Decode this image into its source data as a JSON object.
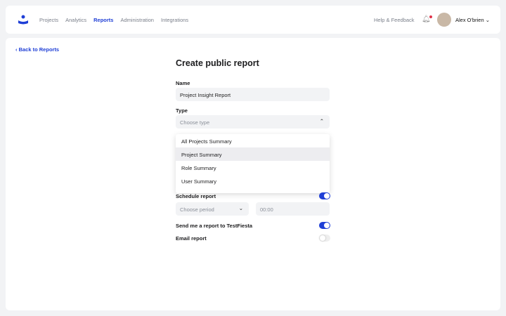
{
  "nav": {
    "items": [
      "Projects",
      "Analytics",
      "Reports",
      "Administration",
      "Integrations"
    ],
    "active": "Reports",
    "help": "Help & Feedback",
    "user": "Alex O'brien"
  },
  "back": "Back to Reports",
  "title": "Create public report",
  "name": {
    "label": "Name",
    "value": "Project Insight Report"
  },
  "type": {
    "label": "Type",
    "placeholder": "Choose type",
    "options": [
      "All Projects Summary",
      "Project Summary",
      "Role Summary",
      "User Summary"
    ],
    "hovered": "Project Summary"
  },
  "schedule": {
    "label": "Schedule report",
    "on": true,
    "period_placeholder": "Choose period",
    "time_placeholder": "00:00"
  },
  "send": {
    "label": "Send me a report to TestFiesta",
    "on": true
  },
  "email": {
    "label": "Email report",
    "on": false
  }
}
